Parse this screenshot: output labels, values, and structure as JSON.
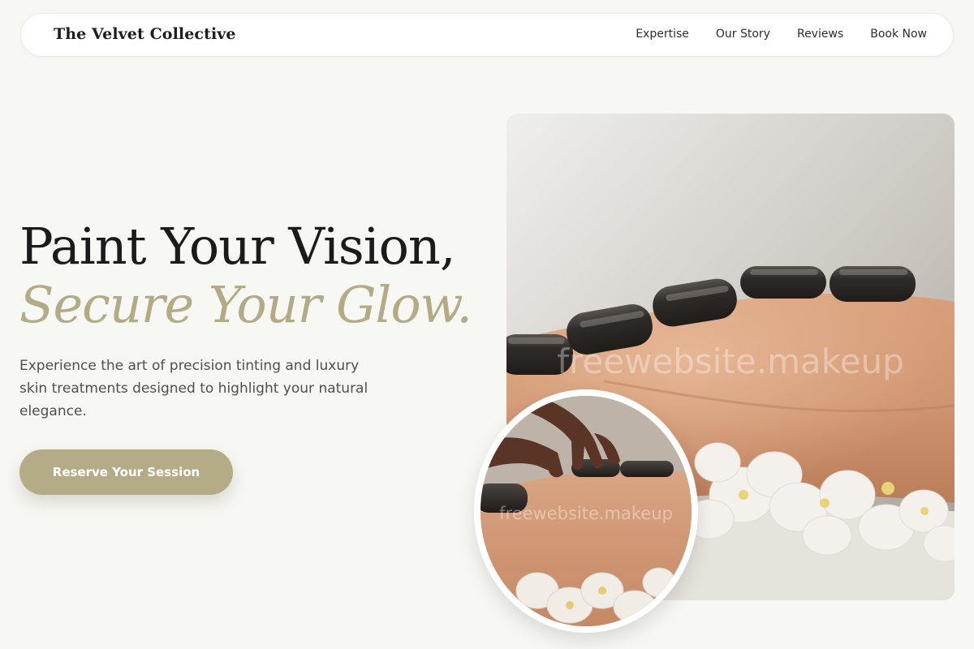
{
  "header": {
    "brand": "The Velvet Collective",
    "nav": [
      {
        "label": "Expertise"
      },
      {
        "label": "Our Story"
      },
      {
        "label": "Reviews"
      },
      {
        "label": "Book Now"
      }
    ]
  },
  "hero": {
    "title_line1": "Paint Your Vision,",
    "title_line2": "Secure Your Glow.",
    "description": "Experience the art of precision tinting and luxury skin treatments designed to highlight your natural elegance.",
    "cta_label": "Reserve Your Session"
  },
  "images": {
    "watermark": "freewebsite.makeup"
  },
  "colors": {
    "background": "#f7f7f3",
    "accent": "#b4ac86",
    "text_dark": "#1b1b1b"
  }
}
